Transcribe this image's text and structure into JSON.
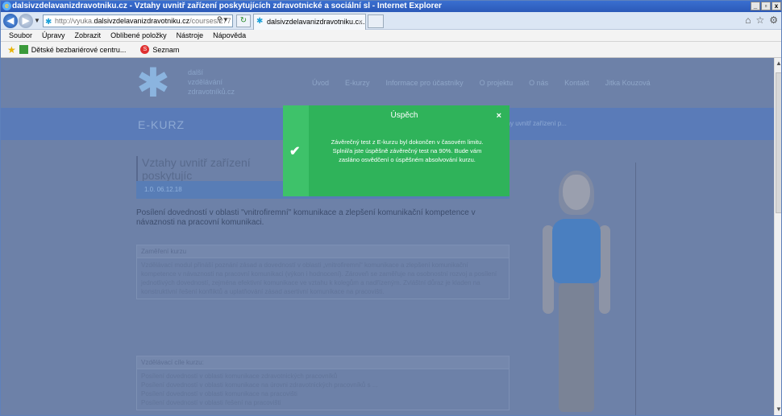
{
  "window": {
    "title": "dalsivzdelavanizdravotniku.cz - Vztahy uvnitř zařízení poskytujících zdravotnické a sociální sl - Internet Explorer",
    "controls": [
      "_",
      "▫",
      "x"
    ]
  },
  "address_bar": {
    "url_prefix": "http://vyuka.",
    "url_domain": "dalsivzdelavanizdravotniku.cz",
    "url_suffix": "/courses/277",
    "tab_label": "dalsivzdelavanizdravotniku.c..."
  },
  "menu": [
    "Soubor",
    "Úpravy",
    "Zobrazit",
    "Oblíbené položky",
    "Nástroje",
    "Nápověda"
  ],
  "favorites": [
    "Dětské bezbariérové centru...",
    "Seznam"
  ],
  "site": {
    "logo_text": [
      "další",
      "vzdělávání",
      "zdravotníků.cz"
    ],
    "nav": [
      "Úvod",
      "E-kurzy",
      "Informace pro účastníky",
      "O projektu",
      "O nás",
      "Kontakt",
      "Jitka Kouzová"
    ],
    "band_title": "E-KURZ",
    "breadcrumb": "... ztahy uvnitř zařízení p...",
    "page_title": "Vztahy uvnitř zařízení poskytujíc",
    "date": "1.0. 06.12.18",
    "lead": "Posílení dovedností v oblasti \"vnitrofiremní\" komunikace a zlepšení komunikační kompetence v návaznosti na pracovní komunikaci.",
    "box1_title": "Zaměření kurzu",
    "box1_text": "Vzdělávací modul přináší poznání zásad a dovedností v oblasti „vnitrofiremní“ komunikace a zlepšení komunikační kompetence v návaznosti na pracovní komunikaci (výkon i hodnocení). Zároveň se zaměřuje na osobnostní rozvoj a posílení jednotlivých dovedností, zejména efektivní komunikace ve vztahu k kolegům a nadřízeným. Zvláštní důraz je kladen na konstruktivní řešení konfliktů a uplatňování zásad asertivní komunikace na pracovišti.",
    "box2_title": "Vzdělávací cíle kurzu:",
    "box2_items": [
      "Posílení dovedností v oblasti komunikace zdravotnických pracovníků",
      "Posílení dovedností v oblasti komunikace na úrovni zdravotnických pracovníků s ...",
      "Posílení dovedností v oblasti komunikace na pracovišti",
      "Posílení dovedností v oblasti řešení na pracovišti"
    ]
  },
  "modal": {
    "title": "Úspěch",
    "close": "×",
    "check": "✔",
    "message_1": "Závěrečný test z E-kurzu byl dokončen v časovém limitu.",
    "message_2": "Splnil/a jste úspěšně závěrečný test na 90%. Bude vám zasláno osvědčení o úspěšném absolvování kurzu."
  },
  "colors": {
    "modal_green": "#2fb35a",
    "overlay": "#6d81a8",
    "titlebar": "#2b59b8"
  }
}
